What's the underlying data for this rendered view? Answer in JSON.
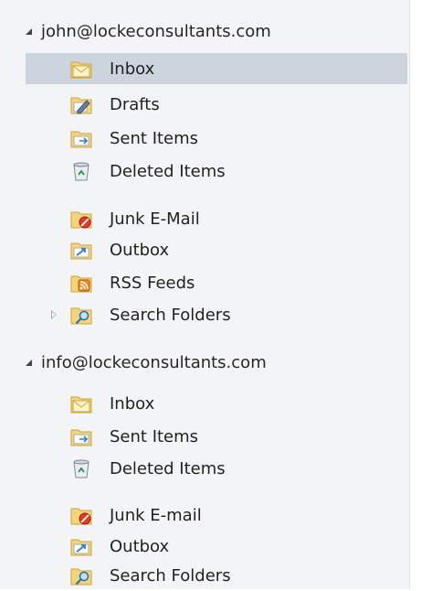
{
  "accounts": [
    {
      "name": "john@lockeconsultants.com",
      "folders": [
        {
          "label": "Inbox",
          "icon": "inbox-folder-icon",
          "selected": true
        },
        {
          "label": "Drafts",
          "icon": "drafts-folder-icon"
        },
        {
          "label": "Sent Items",
          "icon": "sent-items-folder-icon"
        },
        {
          "label": "Deleted Items",
          "icon": "recycle-bin-icon"
        },
        {
          "label": "Junk E-Mail",
          "icon": "junk-mail-folder-icon"
        },
        {
          "label": "Outbox",
          "icon": "outbox-folder-icon"
        },
        {
          "label": "RSS Feeds",
          "icon": "rss-feeds-folder-icon"
        },
        {
          "label": "Search Folders",
          "icon": "search-folder-icon",
          "expandable": true
        }
      ]
    },
    {
      "name": "info@lockeconsultants.com",
      "folders": [
        {
          "label": "Inbox",
          "icon": "inbox-folder-icon"
        },
        {
          "label": "Sent Items",
          "icon": "sent-items-folder-icon"
        },
        {
          "label": "Deleted Items",
          "icon": "recycle-bin-icon"
        },
        {
          "label": "Junk E-mail",
          "icon": "junk-mail-folder-icon"
        },
        {
          "label": "Outbox",
          "icon": "outbox-folder-icon"
        },
        {
          "label": "Search Folders",
          "icon": "search-folder-icon"
        }
      ]
    }
  ],
  "colors": {
    "selected_row": "#ccd4dd",
    "pane_background": "#f3f4f6",
    "folder_yellow": "#f4d57b"
  }
}
